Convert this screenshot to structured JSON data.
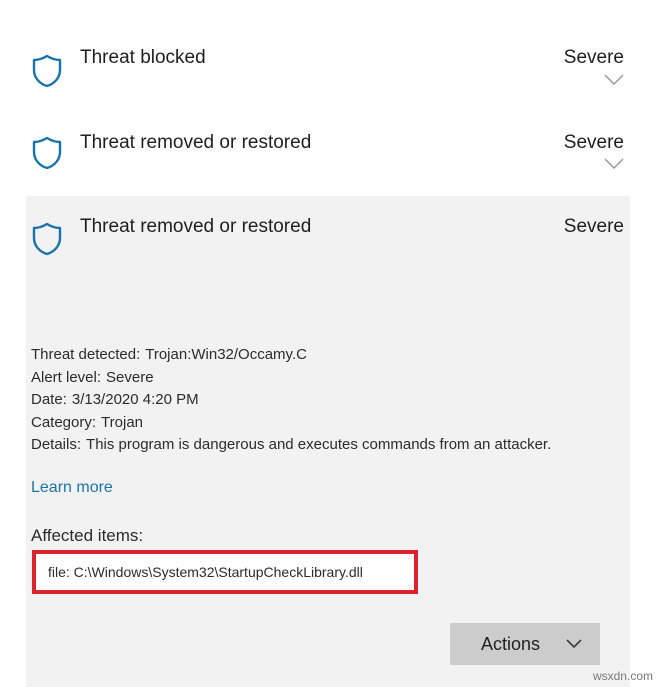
{
  "threats": [
    {
      "title": "Threat blocked",
      "severity": "Severe",
      "icon": "shield-icon",
      "expanded": false
    },
    {
      "title": "Threat removed or restored",
      "severity": "Severe",
      "icon": "shield-icon",
      "expanded": false
    },
    {
      "title": "Threat removed or restored",
      "severity": "Severe",
      "icon": "shield-icon",
      "expanded": true
    }
  ],
  "details": {
    "threat_detected_label": "Threat detected:",
    "threat_detected_value": "Trojan:Win32/Occamy.C",
    "alert_level_label": "Alert level:",
    "alert_level_value": "Severe",
    "date_label": "Date:",
    "date_value": "3/13/2020 4:20 PM",
    "category_label": "Category:",
    "category_value": "Trojan",
    "details_label": "Details:",
    "details_value": "This program is dangerous and executes commands from an attacker."
  },
  "learn_more": "Learn more",
  "affected_items_label": "Affected items:",
  "affected_file": "file: C:\\Windows\\System32\\StartupCheckLibrary.dll",
  "actions_label": "Actions",
  "watermark": "wsxdn.com",
  "colors": {
    "shield": "#1a73a8",
    "highlight_border": "#d9242b",
    "link": "#1a73a8",
    "expanded_bg": "#f2f2f2",
    "button_bg": "#cccccc"
  }
}
